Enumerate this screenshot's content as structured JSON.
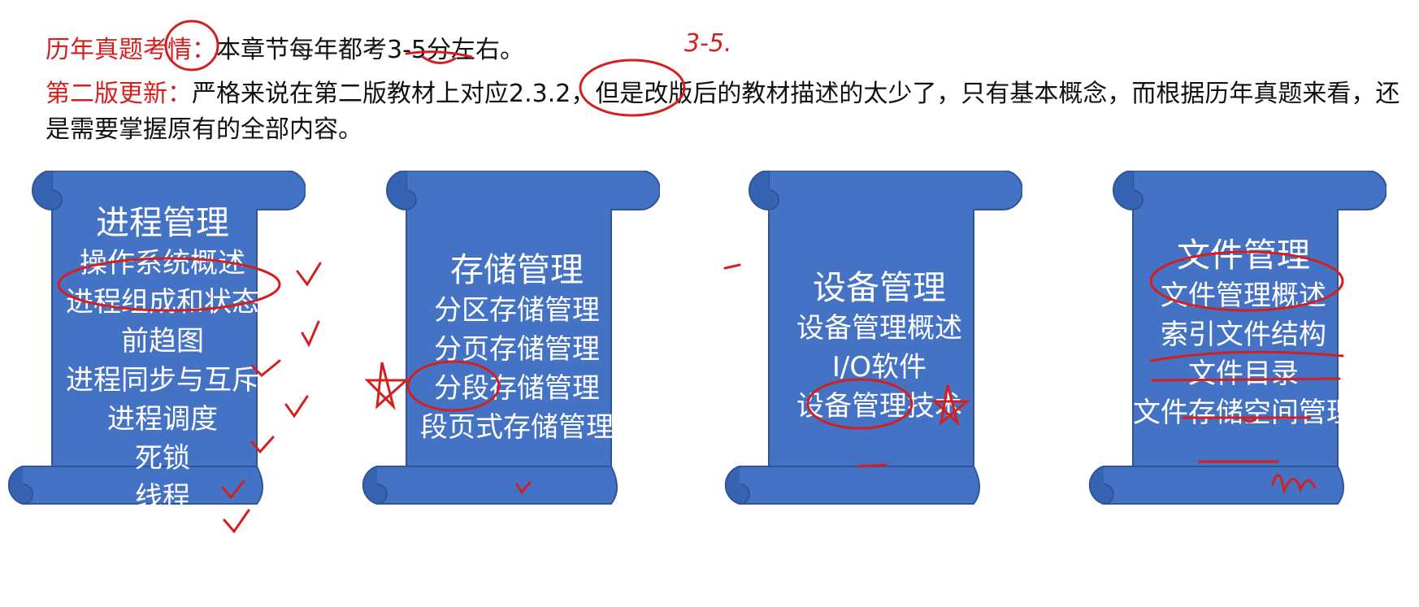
{
  "header": {
    "exam_label": "历年真题考情：",
    "exam_text": "本章节每年都考3-5分左右。",
    "update_label": "第二版更新：",
    "update_text": "严格来说在第二版教材上对应2.3.2，但是改版后的教材描述的太少了，只有基本概念，而根据历年真题来看，还是需要掌握原有的全部内容。"
  },
  "annotations": {
    "score_note": "3-5."
  },
  "scrolls": [
    {
      "title": "进程管理",
      "items": [
        "操作系统概述",
        "进程组成和状态",
        "前趋图",
        "进程同步与互斥",
        "进程调度",
        "死锁",
        "线程"
      ]
    },
    {
      "title": "存储管理",
      "items": [
        "分区存储管理",
        "分页存储管理",
        "分段存储管理",
        "段页式存储管理"
      ]
    },
    {
      "title": "设备管理",
      "items": [
        "设备管理概述",
        "I/O软件",
        "设备管理技术"
      ]
    },
    {
      "title": "文件管理",
      "items": [
        "文件管理概述",
        "索引文件结构",
        "文件目录",
        "文件存储空间管理"
      ]
    }
  ],
  "colors": {
    "accent_red": "#d51f1f",
    "scroll_fill": "#4472c4",
    "scroll_edge": "#2f5597"
  }
}
